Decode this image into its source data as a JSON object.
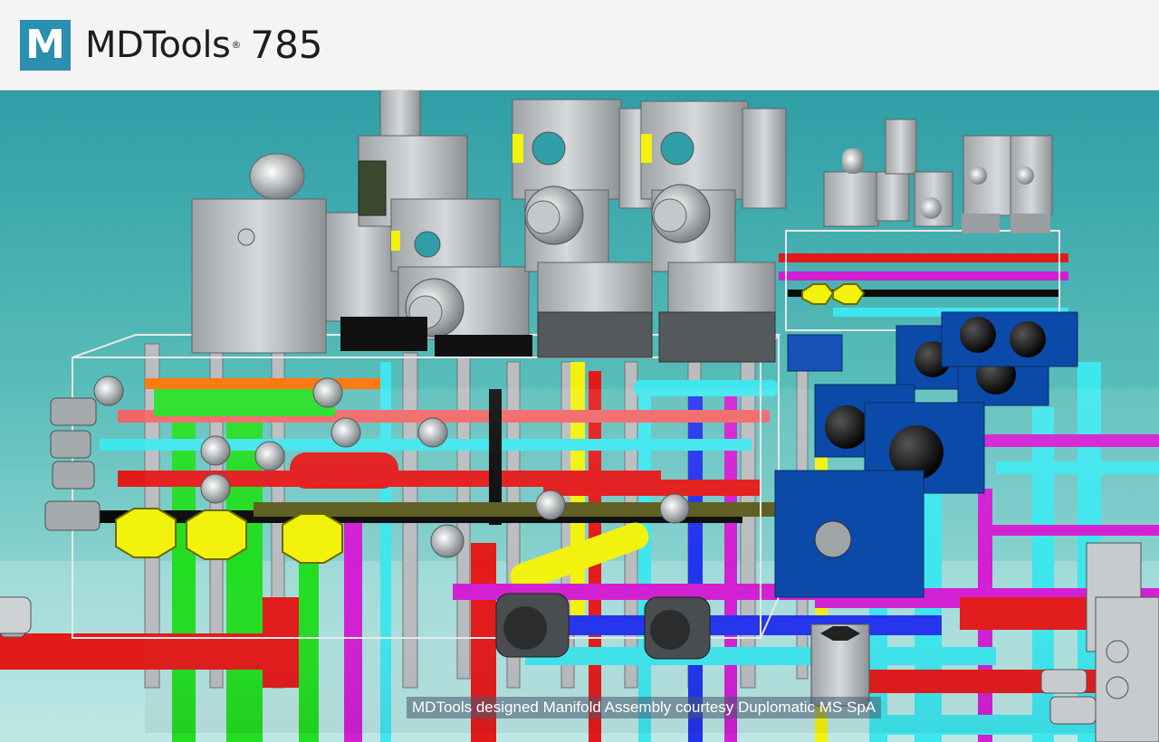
{
  "header": {
    "logo_letter": "M",
    "brand_name": "MDTools",
    "registered_mark": "®",
    "version": "785"
  },
  "viewport": {
    "caption": "MDTools designed Manifold Assembly courtesy Duplomatic MS SpA"
  },
  "colors": {
    "logo": "#2a8fb0",
    "background": "#3aa7ad",
    "pipe_red": "#e31a1a",
    "pipe_green": "#22dd22",
    "pipe_cyan": "#3ee6ee",
    "pipe_yellow": "#f2f20d",
    "pipe_blue": "#2233ee",
    "pipe_magenta": "#d21fd2",
    "valve_blue": "#0b4aa8",
    "valve_gray": "#b8bcbf"
  }
}
